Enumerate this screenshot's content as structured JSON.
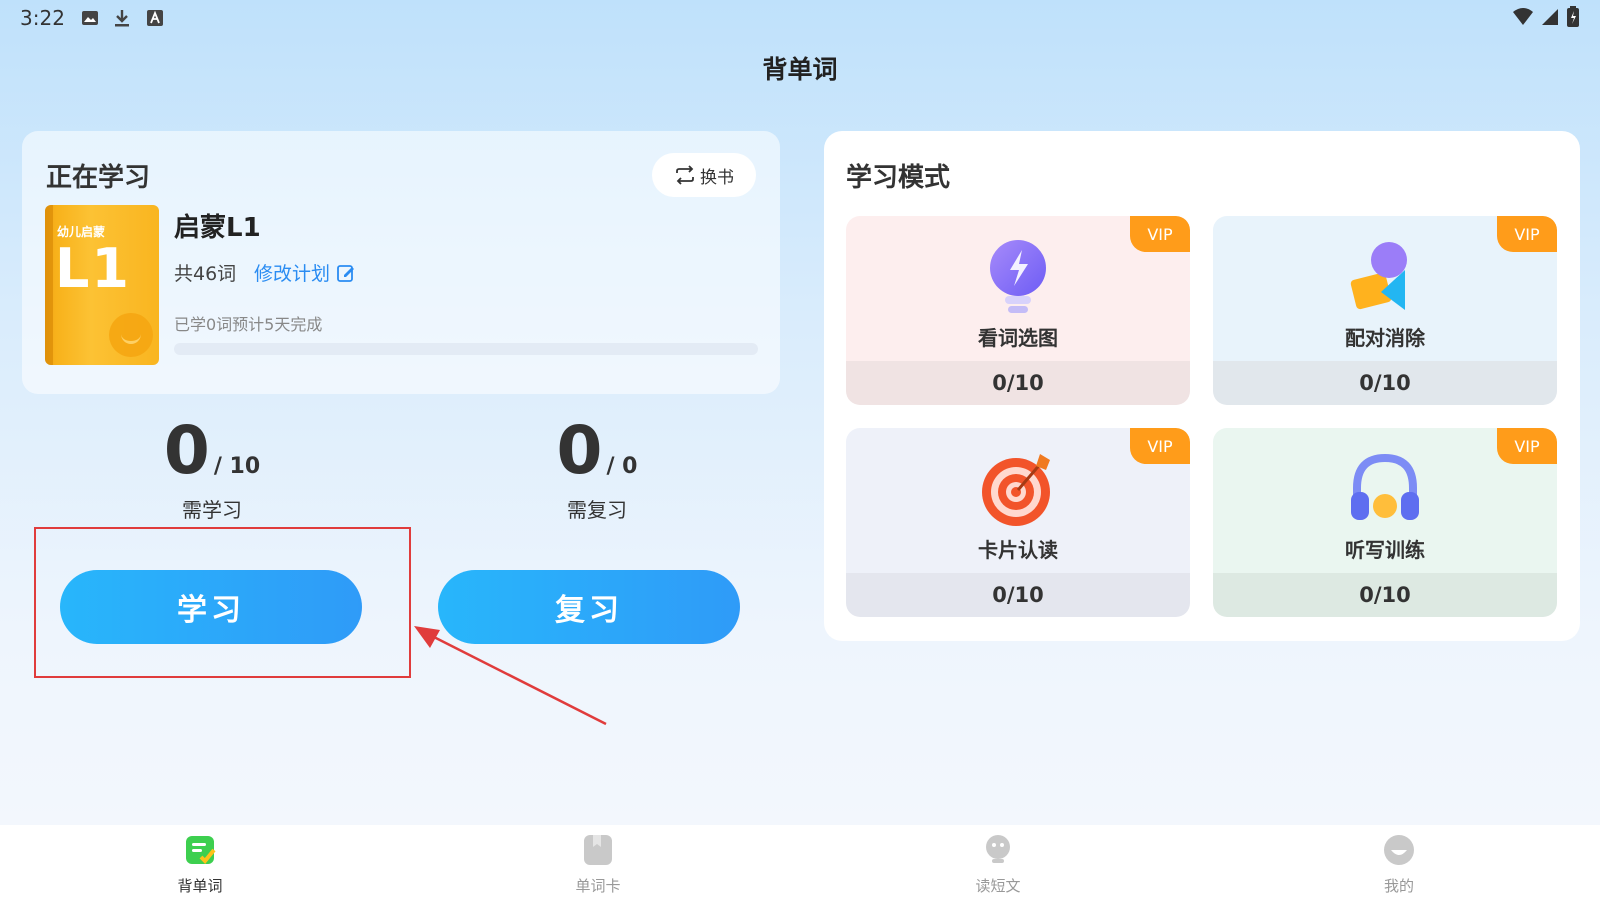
{
  "status_bar": {
    "time": "3:22"
  },
  "header": {
    "title": "背单词"
  },
  "current_study": {
    "section_title": "正在学习",
    "switch_book_label": "换书",
    "book_cover_subtitle": "幼儿启蒙",
    "book_cover_big": "L1",
    "book_name": "启蒙L1",
    "word_count": "共46词",
    "edit_plan_label": "修改计划",
    "progress_text": "已学0词预计5天完成",
    "progress_fraction": 0
  },
  "stats": {
    "learn": {
      "value": "0",
      "total": "/ 10",
      "label": "需学习"
    },
    "review": {
      "value": "0",
      "total": "/ 0",
      "label": "需复习"
    }
  },
  "buttons": {
    "learn_label": "学习",
    "review_label": "复习"
  },
  "study_modes": {
    "title": "学习模式",
    "vip_label": "VIP",
    "tiles": [
      {
        "name": "看词选图",
        "progress": "0/10",
        "icon": "lightbulb-icon"
      },
      {
        "name": "配对消除",
        "progress": "0/10",
        "icon": "shapes-icon"
      },
      {
        "name": "卡片认读",
        "progress": "0/10",
        "icon": "target-icon"
      },
      {
        "name": "听写训练",
        "progress": "0/10",
        "icon": "headphones-icon"
      }
    ]
  },
  "bottom_nav": {
    "items": [
      {
        "label": "背单词",
        "icon": "vocab-icon",
        "active": true
      },
      {
        "label": "单词卡",
        "icon": "card-icon",
        "active": false
      },
      {
        "label": "读短文",
        "icon": "reading-icon",
        "active": false
      },
      {
        "label": "我的",
        "icon": "profile-icon",
        "active": false
      }
    ]
  },
  "colors": {
    "accent_blue": "#2f9bf8",
    "vip_orange": "#ff9c1a",
    "annotation_red": "#e03c3c"
  }
}
